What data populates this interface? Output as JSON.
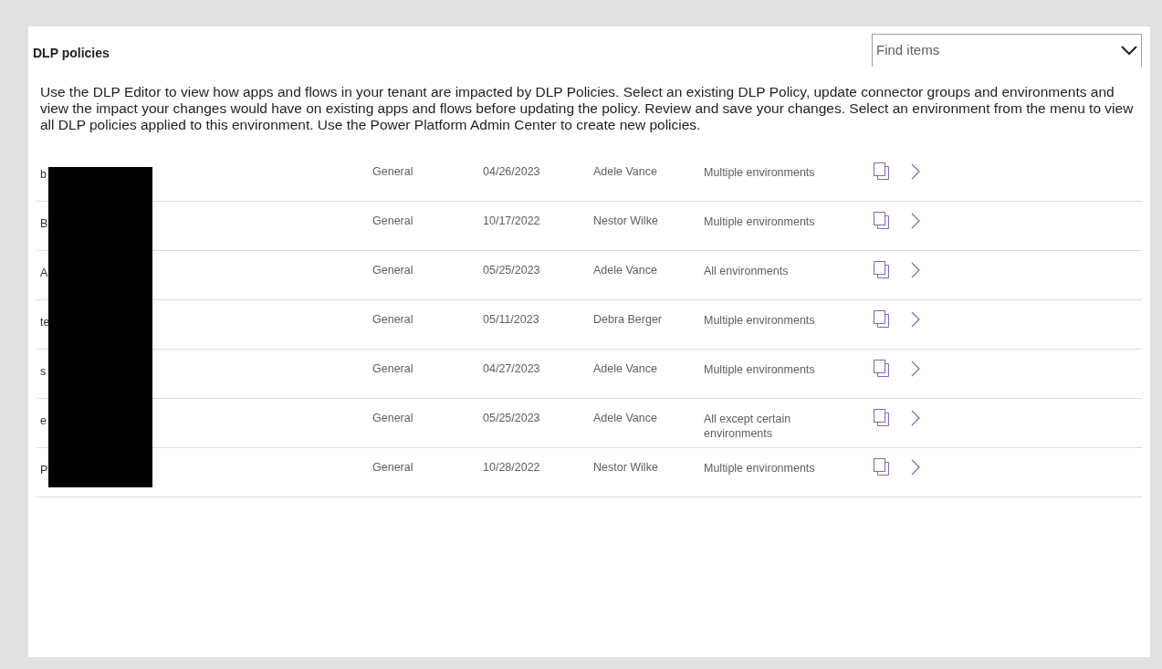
{
  "title": "DLP policies",
  "search": {
    "placeholder": "Find items"
  },
  "description": "Use the DLP Editor to view how apps and flows in your tenant are impacted by DLP Policies. Select an existing DLP Policy, update connector groups and environments and view the impact your changes would have on existing apps and flows before updating the policy. Review and save your changes. Select an environment from the menu to view all DLP policies applied to this environment. Use the Power Platform Admin Center to create new policies.",
  "policies": [
    {
      "name": "b",
      "type": "General",
      "date": "04/26/2023",
      "owner": "Adele Vance",
      "scope": "Multiple environments"
    },
    {
      "name": "B",
      "type": "General",
      "date": "10/17/2022",
      "owner": "Nestor Wilke",
      "scope": "Multiple environments"
    },
    {
      "name": "A",
      "type": "General",
      "date": "05/25/2023",
      "owner": "Adele Vance",
      "scope": "All environments"
    },
    {
      "name": "te",
      "type": "General",
      "date": "05/11/2023",
      "owner": "Debra Berger",
      "scope": "Multiple environments"
    },
    {
      "name": "s",
      "type": "General",
      "date": "04/27/2023",
      "owner": "Adele Vance",
      "scope": "Multiple environments"
    },
    {
      "name": "e",
      "type": "General",
      "date": "05/25/2023",
      "owner": "Adele Vance",
      "scope": "All except certain environments"
    },
    {
      "name": "P",
      "type": "General",
      "date": "10/28/2022",
      "owner": "Nestor Wilke",
      "scope": "Multiple environments"
    }
  ]
}
